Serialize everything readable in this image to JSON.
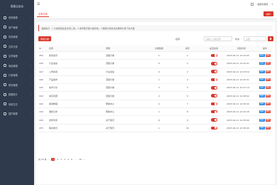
{
  "app": {
    "brand": "智能云后台"
  },
  "sidebar": {
    "items": [
      {
        "label": "系统管理",
        "icon": "gear-icon"
      },
      {
        "label": "用户管理",
        "icon": "user-icon"
      },
      {
        "label": "内容管理",
        "icon": "file-icon"
      },
      {
        "label": "文章分类",
        "icon": "folder-icon"
      },
      {
        "label": "文章管理",
        "icon": "document-icon"
      },
      {
        "label": "商品管理",
        "icon": "box-icon"
      },
      {
        "label": "订单管理",
        "icon": "cart-icon"
      },
      {
        "label": "财务管理",
        "icon": "wallet-icon"
      },
      {
        "label": "数据统计",
        "icon": "chart-icon"
      },
      {
        "label": "系统日志",
        "icon": "log-icon"
      },
      {
        "label": "插件管理",
        "icon": "plugin-icon"
      }
    ]
  },
  "topbar": {
    "user": "超级管理员"
  },
  "tabs": {
    "active": "文章分类",
    "more": "操作"
  },
  "notice": "温馨提示：1.分类层级最多支持三级；2.排序数字越小越靠前；3.删除分类前请先删除分类下的文章",
  "toolbar": {
    "add_label": "添加分类",
    "name_label": "名称",
    "name_placeholder": "请输入分类名称",
    "status_label": "状态",
    "status_placeholder": "全部"
  },
  "table": {
    "columns": [
      "ID",
      "名称",
      "所属",
      "文章数量",
      "排序",
      "是否启用",
      "创建时间",
      "操作"
    ],
    "rows": [
      {
        "id": "450",
        "name": "新闻资讯",
        "parent": "顶级分类",
        "count": "1",
        "sort": "1",
        "date": "2023-04-11 12:22:05"
      },
      {
        "id": "449",
        "name": "行业动态",
        "parent": "顶级分类",
        "count": "5",
        "sort": "2",
        "date": "2023-04-11 12:22:41"
      },
      {
        "id": "447",
        "name": "公司新闻",
        "parent": "行业动态",
        "count": "0",
        "sort": "3",
        "date": "2023-04-11 12:23:24"
      },
      {
        "id": "446",
        "name": "产品发布",
        "parent": "顶级分类",
        "count": "1",
        "sort": "4",
        "date": "2023-04-11 12:25:31"
      },
      {
        "id": "445",
        "name": "技术分享",
        "parent": "顶级分类",
        "count": "3",
        "sort": "5",
        "date": "2023-04-11 12:27:14"
      },
      {
        "id": "443",
        "name": "常见问题",
        "parent": "顶级分类",
        "count": "2",
        "sort": "6",
        "date": "2023-04-11 12:28:02"
      },
      {
        "id": "442",
        "name": "使用教程",
        "parent": "帮助中心",
        "count": "4",
        "sort": "7",
        "date": "2023-04-11 12:30:44"
      },
      {
        "id": "440",
        "name": "更新日志",
        "parent": "帮助中心",
        "count": "1",
        "sort": "8",
        "date": "2023-04-11 12:32:18"
      },
      {
        "id": "436",
        "name": "合作伙伴",
        "parent": "关于我们",
        "count": "6",
        "sort": "9",
        "date": "2023-04-11 12:35:09"
      },
      {
        "id": "435",
        "name": "联系我们",
        "parent": "关于我们",
        "count": "1",
        "sort": "10",
        "date": "2023-04-11 12:36:40"
      }
    ],
    "edit_label": "编辑",
    "delete_label": "删除"
  },
  "pager": {
    "total": "共 10 条",
    "pages": [
      "‹",
      "1",
      "2",
      "3",
      "4",
      "5",
      "6",
      "…",
      "18",
      "›"
    ],
    "active": "1"
  },
  "colors": {
    "accent": "#d9382c",
    "sidebar": "#2f3b4c",
    "edit": "#2e86de",
    "delete": "#e14b3b"
  }
}
